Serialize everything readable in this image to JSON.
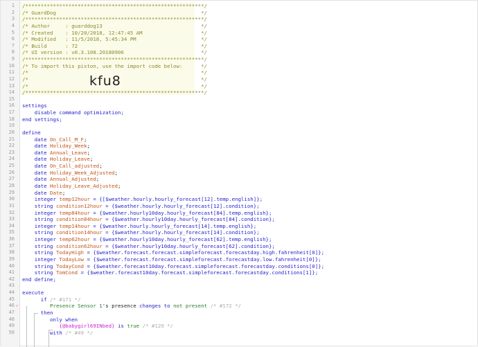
{
  "editor": {
    "import_code": "kfu8",
    "lines": [
      {
        "n": "1",
        "segments": [
          {
            "t": "/**********************************************************/",
            "c": "c"
          }
        ]
      },
      {
        "n": "2",
        "segments": [
          {
            "t": "/* GuardDog                                               */",
            "c": "c"
          }
        ]
      },
      {
        "n": "3",
        "segments": [
          {
            "t": "/**********************************************************/",
            "c": "c"
          }
        ]
      },
      {
        "n": "4",
        "segments": [
          {
            "t": "/* Author     : guarddog13                                */",
            "c": "c"
          }
        ]
      },
      {
        "n": "5",
        "segments": [
          {
            "t": "/* Created    : 10/20/2018, 12:47:45 AM                   */",
            "c": "c"
          }
        ]
      },
      {
        "n": "6",
        "segments": [
          {
            "t": "/* Modified   : 11/5/2018, 5:45:34 PM                     */",
            "c": "c"
          }
        ]
      },
      {
        "n": "7",
        "segments": [
          {
            "t": "/* Build      : 72                                        */",
            "c": "c"
          }
        ]
      },
      {
        "n": "8",
        "segments": [
          {
            "t": "/* UI version : v0.3.108.20180906                         */",
            "c": "c"
          }
        ]
      },
      {
        "n": "9",
        "segments": [
          {
            "t": "/**********************************************************/",
            "c": "c"
          }
        ]
      },
      {
        "n": "10",
        "segments": [
          {
            "t": "/* To import this piston, use the import code below:      */",
            "c": "c"
          }
        ]
      },
      {
        "n": "11",
        "segments": [
          {
            "t": "/*                                                        */",
            "c": "c"
          }
        ]
      },
      {
        "n": "12",
        "segments": [
          {
            "t": "/*                                                        */",
            "c": "c"
          }
        ]
      },
      {
        "n": "13",
        "segments": [
          {
            "t": "/*                                                        */",
            "c": "c"
          }
        ]
      },
      {
        "n": "14",
        "segments": [
          {
            "t": "/**********************************************************/",
            "c": "c"
          }
        ]
      },
      {
        "n": "15",
        "segments": []
      },
      {
        "n": "16",
        "segments": [
          {
            "t": "settings",
            "c": "k"
          }
        ]
      },
      {
        "n": "17",
        "segments": [
          {
            "t": "    disable command optimization;",
            "c": "k"
          }
        ]
      },
      {
        "n": "18",
        "segments": [
          {
            "t": "end settings;",
            "c": "k"
          }
        ]
      },
      {
        "n": "19",
        "segments": []
      },
      {
        "n": "20",
        "segments": [
          {
            "t": "define",
            "c": "k"
          }
        ]
      },
      {
        "n": "21",
        "segments": [
          {
            "t": "    date ",
            "c": "k"
          },
          {
            "t": "On_Call_M_F",
            "c": "d"
          },
          {
            "t": ";",
            "c": "p"
          }
        ]
      },
      {
        "n": "22",
        "segments": [
          {
            "t": "    date ",
            "c": "k"
          },
          {
            "t": "Holiday_Week",
            "c": "d"
          },
          {
            "t": ";",
            "c": "p"
          }
        ]
      },
      {
        "n": "23",
        "segments": [
          {
            "t": "    date ",
            "c": "k"
          },
          {
            "t": "Annual_Leave",
            "c": "d"
          },
          {
            "t": ";",
            "c": "p"
          }
        ]
      },
      {
        "n": "24",
        "segments": [
          {
            "t": "    date ",
            "c": "k"
          },
          {
            "t": "Holiday_Leave",
            "c": "d"
          },
          {
            "t": ";",
            "c": "p"
          }
        ]
      },
      {
        "n": "25",
        "segments": [
          {
            "t": "    date ",
            "c": "k"
          },
          {
            "t": "On_Call_adjusted",
            "c": "d"
          },
          {
            "t": ";",
            "c": "p"
          }
        ]
      },
      {
        "n": "26",
        "segments": [
          {
            "t": "    date ",
            "c": "k"
          },
          {
            "t": "Holiday_Week_Adjusted",
            "c": "d"
          },
          {
            "t": ";",
            "c": "p"
          }
        ]
      },
      {
        "n": "27",
        "segments": [
          {
            "t": "    date ",
            "c": "k"
          },
          {
            "t": "Annual_Adjusted",
            "c": "d"
          },
          {
            "t": ";",
            "c": "p"
          }
        ]
      },
      {
        "n": "28",
        "segments": [
          {
            "t": "    date ",
            "c": "k"
          },
          {
            "t": "Holiday_Leave_Adjusted",
            "c": "d"
          },
          {
            "t": ";",
            "c": "p"
          }
        ]
      },
      {
        "n": "29",
        "segments": [
          {
            "t": "    date ",
            "c": "k"
          },
          {
            "t": "Date",
            "c": "d"
          },
          {
            "t": ";",
            "c": "p"
          }
        ]
      },
      {
        "n": "30",
        "segments": [
          {
            "t": "    integer ",
            "c": "k"
          },
          {
            "t": "temp12hour",
            "c": "d"
          },
          {
            "t": " = {[$weather.hourly.hourly_forecast[12].temp.english]};",
            "c": "k"
          }
        ]
      },
      {
        "n": "31",
        "segments": [
          {
            "t": "    string ",
            "c": "k"
          },
          {
            "t": "condition12hour",
            "c": "d"
          },
          {
            "t": " = {$weather.hourly.hourly_forecast[12].condition};",
            "c": "k"
          }
        ]
      },
      {
        "n": "32",
        "segments": [
          {
            "t": "    integer ",
            "c": "k"
          },
          {
            "t": "temp84hour",
            "c": "d"
          },
          {
            "t": " = {$weather.hourly10day.hourly_forecast[84].temp.english};",
            "c": "k"
          }
        ]
      },
      {
        "n": "33",
        "segments": [
          {
            "t": "    string ",
            "c": "k"
          },
          {
            "t": "condition84hour",
            "c": "d"
          },
          {
            "t": " = {$weather.hourly10day.hourly_forecast[84].condition};",
            "c": "k"
          }
        ]
      },
      {
        "n": "34",
        "segments": [
          {
            "t": "    integer ",
            "c": "k"
          },
          {
            "t": "temp14hour",
            "c": "d"
          },
          {
            "t": " = {$weather.hourly.hourly_forecast[14].temp.english};",
            "c": "k"
          }
        ]
      },
      {
        "n": "35",
        "segments": [
          {
            "t": "    string ",
            "c": "k"
          },
          {
            "t": "condition14hour",
            "c": "d"
          },
          {
            "t": " = {$weather.hourly.hourly_forecast[14].condition};",
            "c": "k"
          }
        ]
      },
      {
        "n": "36",
        "segments": [
          {
            "t": "    integer ",
            "c": "k"
          },
          {
            "t": "temp62hour",
            "c": "d"
          },
          {
            "t": " = {$weather.hourly10day.hourly_forecast[62].temp.english};",
            "c": "k"
          }
        ]
      },
      {
        "n": "37",
        "segments": [
          {
            "t": "    string ",
            "c": "k"
          },
          {
            "t": "condition62hour",
            "c": "d"
          },
          {
            "t": " = {$weather.hourly10day.hourly_forecast[62].condition};",
            "c": "k"
          }
        ]
      },
      {
        "n": "38",
        "segments": [
          {
            "t": "    string ",
            "c": "k"
          },
          {
            "t": "TodayHigh",
            "c": "d"
          },
          {
            "t": " = {$weather.forecast.forecast.simpleforecast.forecastday.high.fahrenheit[0]};",
            "c": "k"
          }
        ]
      },
      {
        "n": "39",
        "segments": [
          {
            "t": "    integer ",
            "c": "k"
          },
          {
            "t": "TodayLow",
            "c": "d"
          },
          {
            "t": " = {$weather.forecast.forecast.simpleforecast.forecastday.low.fahrenheit[0]};",
            "c": "k"
          }
        ]
      },
      {
        "n": "40",
        "segments": [
          {
            "t": "    string ",
            "c": "k"
          },
          {
            "t": "TodayCond",
            "c": "d"
          },
          {
            "t": " = {$weather.forecast10day.forecast.simpleforecast.forecastday.conditions[0]};",
            "c": "k"
          }
        ]
      },
      {
        "n": "41",
        "segments": [
          {
            "t": "    string ",
            "c": "k"
          },
          {
            "t": "TomCond",
            "c": "d"
          },
          {
            "t": " = {$weather.forecast10day.forecast.simpleforecast.forecastday.conditions[1]};",
            "c": "k"
          }
        ]
      },
      {
        "n": "42",
        "segments": [
          {
            "t": "end define;",
            "c": "k"
          }
        ]
      },
      {
        "n": "43",
        "segments": []
      },
      {
        "n": "44",
        "segments": [
          {
            "t": "execute",
            "c": "k"
          }
        ]
      },
      {
        "n": "45",
        "segments": [
          {
            "t": "      if ",
            "c": "k"
          },
          {
            "t": "/* #171 */",
            "c": "cm"
          }
        ]
      },
      {
        "n": "46",
        "marker": "✓",
        "segments": [
          {
            "t": "         Presence Sensor 1",
            "c": "v"
          },
          {
            "t": "'s ",
            "c": "p"
          },
          {
            "t": "presence",
            "c": "p"
          },
          {
            "t": " changes to ",
            "c": "k"
          },
          {
            "t": "not present",
            "c": "v"
          },
          {
            "t": " /* #172 */",
            "c": "cm"
          }
        ]
      },
      {
        "n": "47",
        "segments": [
          {
            "t": "      then",
            "c": "k"
          }
        ]
      },
      {
        "n": "48",
        "segments": [
          {
            "t": "         only when",
            "c": "k"
          }
        ]
      },
      {
        "n": "49",
        "segments": [
          {
            "t": "            {@babygirl69INbed}",
            "c": "g"
          },
          {
            "t": " is ",
            "c": "k"
          },
          {
            "t": "true",
            "c": "v"
          },
          {
            "t": " /* #129 */",
            "c": "cm"
          }
        ]
      },
      {
        "n": "50",
        "segments": [
          {
            "t": "         with ",
            "c": "k"
          },
          {
            "t": "/* #49 */",
            "c": "cm"
          }
        ]
      }
    ]
  }
}
